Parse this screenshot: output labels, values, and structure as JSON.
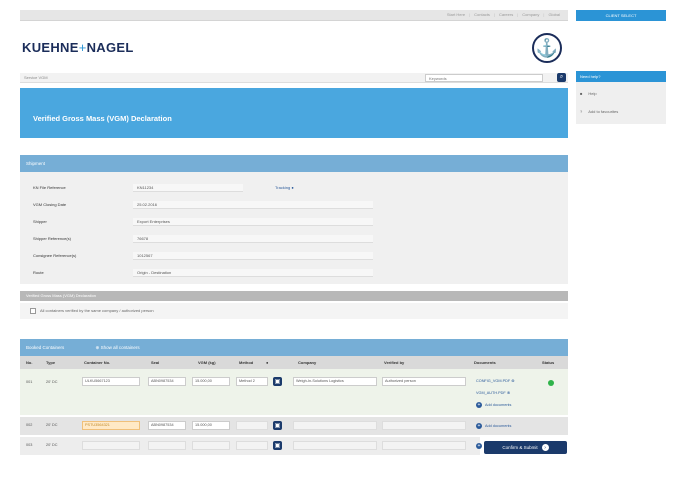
{
  "header": {
    "top_links": [
      "Start Here",
      "Contacts",
      "Careers",
      "Company",
      "Global"
    ],
    "client_button": "CLIENT SELECT",
    "logo_left": "KUEHNE",
    "logo_sep": "+",
    "logo_right": "NAGEL",
    "search_crumb": "Service VGM",
    "search_placeholder": "Keywords"
  },
  "help": {
    "title": "Need help?",
    "items": [
      {
        "icon": "■",
        "label": "Help"
      },
      {
        "icon": "?",
        "label": "Add to favourites"
      }
    ]
  },
  "banner": {
    "title": "Verified Gross Mass (VGM) Declaration"
  },
  "shipment": {
    "section_title": "Shipment",
    "tracking_label": "Tracking",
    "rows": [
      {
        "label": "KN File Reference",
        "value": "KN11234"
      },
      {
        "label": "VGM Closing Date",
        "value": "25.02.2016"
      },
      {
        "label": "Shipper",
        "value": "Export Enterprises"
      },
      {
        "label": "Shipper Reference(s)",
        "value": "76678"
      },
      {
        "label": "Consignee Reference(s)",
        "value": "1012567"
      },
      {
        "label": "Route",
        "value": "Origin - Destination"
      }
    ]
  },
  "declaration": {
    "strip_title": "Verified Gross Mass (VGM) Declaration",
    "text": "All containers verified by the same company / authorized person"
  },
  "containers": {
    "section_title": "Booked Containers",
    "show_all": "Show all containers",
    "columns": [
      "No.",
      "Type",
      "Container No.",
      "Seal",
      "VGM (kg)",
      "Method",
      "Company",
      "Verified by",
      "Documents",
      "Status"
    ],
    "rows": [
      {
        "no": "001",
        "type": "20' DC",
        "container": "ULKU5667123",
        "seal": "ABN0987534",
        "vgm": "15.000,00",
        "method": "Method 2",
        "company": "Weigh-In-Solutions Logistics",
        "verified": "Authorized person",
        "docs": [
          "CONFIG_VGM.PDF",
          "VGM_AUTH.PDF"
        ],
        "add_doc": "Add documents",
        "status": "ok"
      },
      {
        "no": "002",
        "type": "20' DC",
        "container": "PSTU3564321",
        "seal": "ABN0987534",
        "vgm": "15.000,00",
        "method": "",
        "company": "",
        "verified": "",
        "docs": [],
        "add_doc": "Add documents",
        "status": ""
      },
      {
        "no": "003",
        "type": "20' DC",
        "container": "",
        "seal": "",
        "vgm": "",
        "method": "",
        "company": "",
        "verified": "",
        "docs": [],
        "add_doc": "Add documents",
        "status": ""
      }
    ]
  },
  "actions": {
    "confirm": "Confirm & Submit",
    "confirm_icon": "›"
  },
  "colors": {
    "accent": "#2b94d6",
    "navy": "#1b3a6b",
    "section": "#76aed6",
    "status_ok": "#2fb34a"
  }
}
